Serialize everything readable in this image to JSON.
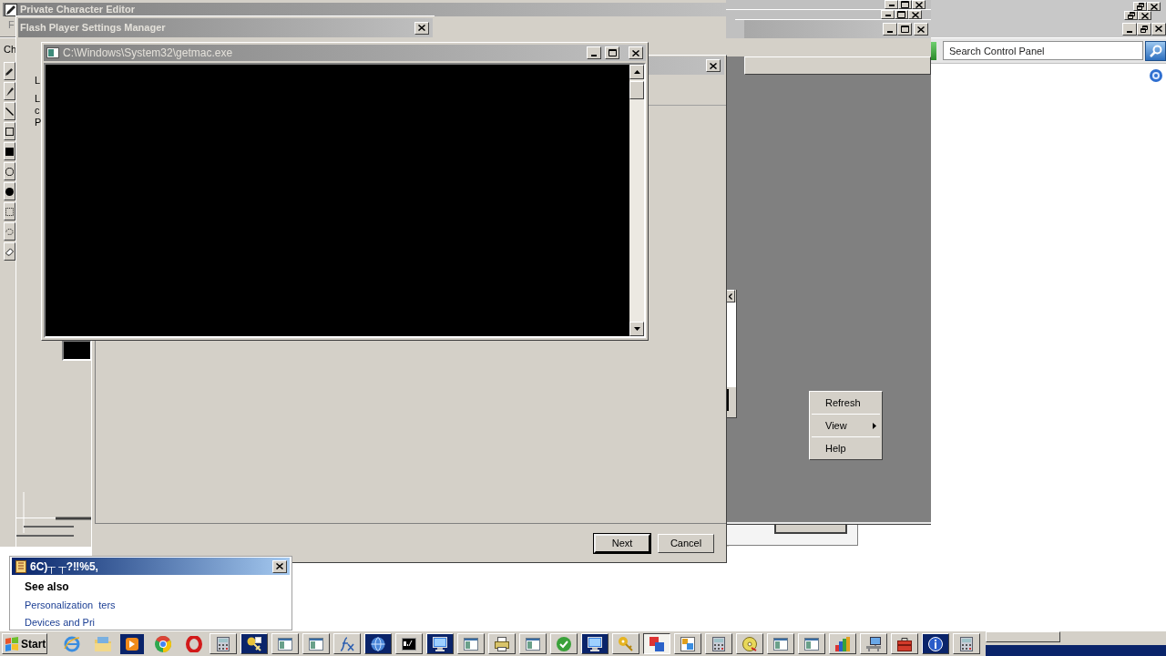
{
  "character_editor": {
    "title": "Private Character Editor",
    "menu_item": "F",
    "label": "Ch"
  },
  "flash_settings": {
    "title": "Flash Player Settings Manager",
    "text_fragments": [
      "L",
      "L",
      "c",
      "P"
    ]
  },
  "console": {
    "title": "C:\\Windows\\System32\\getmac.exe"
  },
  "wizard": {
    "buttons": [
      {
        "label": "Next",
        "default": true
      },
      {
        "label": "Cancel",
        "default": false
      }
    ]
  },
  "context_menu": {
    "items": [
      {
        "label": "Refresh",
        "submenu": false
      },
      {
        "label": "View",
        "submenu": true
      },
      {
        "label": "Help",
        "submenu": false
      }
    ]
  },
  "control_panel": {
    "search": {
      "placeholder": "Search Control Panel"
    }
  },
  "help_panel": {
    "title": "6C)┬ ┬?‼%5,",
    "heading": "See also",
    "links": [
      "Personalization",
      "Devices and Pri"
    ],
    "covered_text": "ters"
  },
  "taskbar": {
    "start": "Start",
    "buttons": [
      {
        "flashing": false,
        "selected": false
      },
      {
        "flashing": true,
        "selected": false
      },
      {
        "flashing": false,
        "selected": false
      },
      {
        "flashing": false,
        "selected": false
      },
      {
        "flashing": false,
        "selected": false
      },
      {
        "flashing": true,
        "selected": false
      },
      {
        "flashing": false,
        "selected": false
      },
      {
        "flashing": true,
        "selected": false
      },
      {
        "flashing": false,
        "selected": false
      },
      {
        "flashing": false,
        "selected": false
      },
      {
        "flashing": false,
        "selected": false
      },
      {
        "flashing": false,
        "selected": false
      },
      {
        "flashing": true,
        "selected": false
      },
      {
        "flashing": false,
        "selected": false
      },
      {
        "flashing": false,
        "selected": true
      },
      {
        "flashing": false,
        "selected": false
      },
      {
        "flashing": false,
        "selected": false
      },
      {
        "flashing": false,
        "selected": false
      },
      {
        "flashing": false,
        "selected": false
      },
      {
        "flashing": false,
        "selected": false
      },
      {
        "flashing": false,
        "selected": false
      },
      {
        "flashing": false,
        "selected": false
      },
      {
        "flashing": false,
        "selected": false
      },
      {
        "flashing": true,
        "selected": false
      },
      {
        "flashing": false,
        "selected": false
      }
    ]
  }
}
